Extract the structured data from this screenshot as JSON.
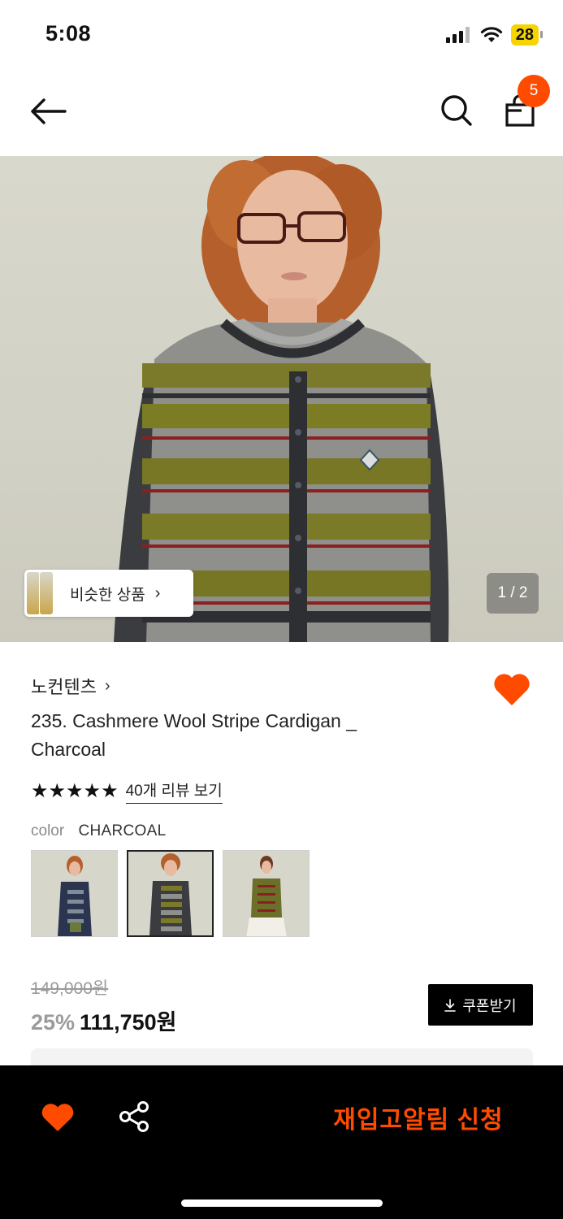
{
  "status_bar": {
    "time": "5:08",
    "battery": "28",
    "icons": [
      "signal-icon",
      "wifi-icon",
      "battery-icon"
    ]
  },
  "nav": {
    "icons": [
      "back-arrow-icon",
      "search-icon",
      "shopping-bag-icon"
    ],
    "cart_count": "5"
  },
  "hero": {
    "similar_label": "비슷한 상품",
    "page_indicator": "1 / 2"
  },
  "product": {
    "brand": "노컨텐츠",
    "title": "235. Cashmere Wool Stripe Cardigan _ Charcoal",
    "rating_stars": 5,
    "review_link": "40개 리뷰 보기",
    "color_label": "color",
    "color_value": "CHARCOAL",
    "swatches": [
      "navy-stripe",
      "charcoal-stripe",
      "olive-stripe"
    ],
    "selected_swatch": 1,
    "wishlisted": true
  },
  "price": {
    "original": "149,000원",
    "discount": "25%",
    "sale": "111,750원",
    "coupon_label": "쿠폰받기"
  },
  "bottom_bar": {
    "restock_label": "재입고알림 신청",
    "icons": [
      "heart-icon",
      "share-icon"
    ]
  },
  "colors": {
    "accent": "#ff4b00",
    "background": "#ffffff",
    "bottom_bar": "#000000",
    "text": "#111111",
    "muted": "#9a9a9a"
  }
}
